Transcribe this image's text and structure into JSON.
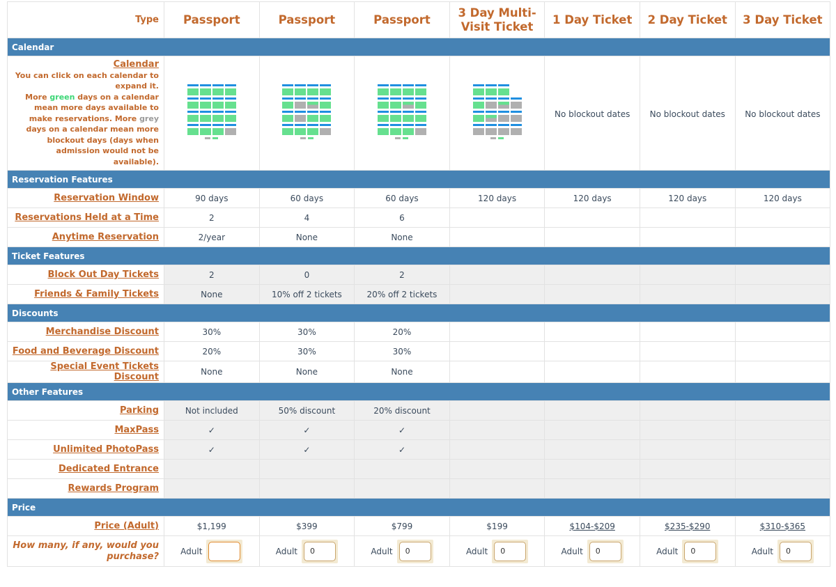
{
  "header": {
    "label": "Type",
    "columns": [
      "Passport",
      "Passport",
      "Passport",
      "3 Day Multi-Visit Ticket",
      "1 Day Ticket",
      "2 Day Ticket",
      "3 Day Ticket"
    ]
  },
  "sections": {
    "calendar": "Calendar",
    "reservation": "Reservation Features",
    "ticket": "Ticket Features",
    "discounts": "Discounts",
    "other": "Other Features",
    "price": "Price"
  },
  "calendar": {
    "title": "Calendar",
    "note_1": "You can click on each calendar to expand it.",
    "note_2a": "More ",
    "note_green": "green",
    "note_2b": " days on a calendar mean more days available to make reservations. More ",
    "note_grey": "grey",
    "note_2c": " days on a calendar mean more blockout days (days when admission would not be available).",
    "no_blockout": "No blockout dates",
    "colors": {
      "green": "#66e08f",
      "grey": "#b0b0b0",
      "header": "#1f8fe0"
    }
  },
  "rows": {
    "reservation_window": {
      "label": "Reservation Window",
      "values": [
        "90 days",
        "60 days",
        "60 days",
        "120 days",
        "120 days",
        "120 days",
        "120 days"
      ]
    },
    "held": {
      "label": "Reservations Held at a Time",
      "values": [
        "2",
        "4",
        "6",
        "",
        "",
        "",
        ""
      ]
    },
    "anytime": {
      "label": "Anytime Reservation ",
      "values": [
        "2/year",
        "None",
        "None",
        "",
        "",
        "",
        ""
      ]
    },
    "blockout": {
      "label": "Block Out Day Tickets",
      "values": [
        "2",
        "0",
        "2",
        "",
        "",
        "",
        ""
      ]
    },
    "friends": {
      "label": "Friends & Family Tickets",
      "values": [
        "None",
        "10% off 2 tickets",
        "20% off 2 tickets",
        "",
        "",
        "",
        ""
      ]
    },
    "merch": {
      "label": "Merchandise Discount",
      "values": [
        "30%",
        "30%",
        "20%",
        "",
        "",
        "",
        ""
      ]
    },
    "food": {
      "label": "Food and Beverage Discount",
      "values": [
        "20%",
        "30%",
        "30%",
        "",
        "",
        "",
        ""
      ]
    },
    "special": {
      "label": "Special Event Tickets Discount",
      "values": [
        "None",
        "None",
        "None",
        "",
        "",
        "",
        ""
      ]
    },
    "parking": {
      "label": "Parking",
      "values": [
        "Not included",
        "50% discount",
        "20% discount",
        "",
        "",
        "",
        ""
      ]
    },
    "maxpass": {
      "label": "MaxPass",
      "values": [
        "✓",
        "✓",
        "✓",
        "",
        "",
        "",
        ""
      ]
    },
    "photopass": {
      "label": "Unlimited PhotoPass",
      "values": [
        "✓",
        "✓",
        "✓",
        "",
        "",
        "",
        ""
      ]
    },
    "entrance": {
      "label": "Dedicated Entrance",
      "values": [
        "",
        "",
        "",
        "",
        "",
        "",
        ""
      ]
    },
    "rewards": {
      "label": "Rewards Program",
      "values": [
        "",
        "",
        "",
        "",
        "",
        "",
        ""
      ]
    },
    "price": {
      "label": "Price (Adult)",
      "values": [
        "$1,199",
        "$399",
        "$799",
        "$199",
        "$104-$209",
        "$235-$290",
        "$310-$365"
      ]
    }
  },
  "purchase": {
    "label": "How many, if any, would you purchase?",
    "adult_label": "Adult",
    "values": [
      "",
      "0",
      "0",
      "0",
      "0",
      "0",
      "0"
    ]
  }
}
